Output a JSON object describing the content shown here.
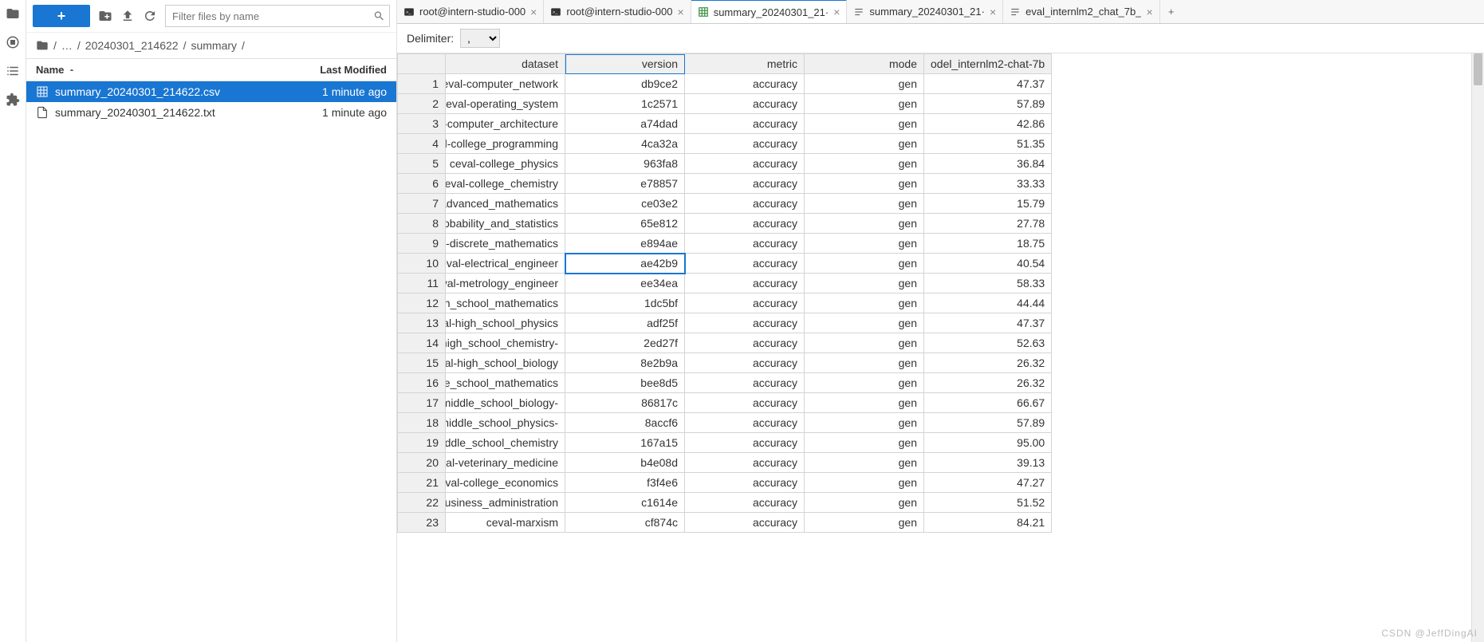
{
  "toolbar": {
    "new_label": "+",
    "filter_placeholder": "Filter files by name"
  },
  "breadcrumb": {
    "ellipsis": "…",
    "parts": [
      "20240301_214622",
      "summary"
    ]
  },
  "file_list": {
    "header_name": "Name",
    "header_modified": "Last Modified",
    "files": [
      {
        "name": "summary_20240301_214622.csv",
        "modified": "1 minute ago",
        "type": "csv",
        "selected": true
      },
      {
        "name": "summary_20240301_214622.txt",
        "modified": "1 minute ago",
        "type": "txt",
        "selected": false
      }
    ]
  },
  "tabs": [
    {
      "label": "root@intern-studio-000",
      "type": "terminal",
      "active": false
    },
    {
      "label": "root@intern-studio-000",
      "type": "terminal",
      "active": false
    },
    {
      "label": "summary_20240301_21·",
      "type": "csv",
      "active": true
    },
    {
      "label": "summary_20240301_21·",
      "type": "txt",
      "active": false
    },
    {
      "label": "eval_internlm2_chat_7b_",
      "type": "txt",
      "active": false
    }
  ],
  "delimiter": {
    "label": "Delimiter:",
    "value": ","
  },
  "chart_data": {
    "type": "table",
    "columns": [
      "dataset",
      "version",
      "metric",
      "mode",
      "odel_internlm2-chat-7b"
    ],
    "rows": [
      [
        "eval-computer_network",
        "db9ce2",
        "accuracy",
        "gen",
        "47.37"
      ],
      [
        "ceval-operating_system",
        "1c2571",
        "accuracy",
        "gen",
        "57.89"
      ],
      [
        "l-computer_architecture",
        "a74dad",
        "accuracy",
        "gen",
        "42.86"
      ],
      [
        "il-college_programming",
        "4ca32a",
        "accuracy",
        "gen",
        "51.35"
      ],
      [
        "ceval-college_physics",
        "963fa8",
        "accuracy",
        "gen",
        "36.84"
      ],
      [
        "ceval-college_chemistry",
        "e78857",
        "accuracy",
        "gen",
        "33.33"
      ],
      [
        "advanced_mathematics",
        "ce03e2",
        "accuracy",
        "gen",
        "15.79"
      ],
      [
        "robability_and_statistics",
        "65e812",
        "accuracy",
        "gen",
        "27.78"
      ],
      [
        "al-discrete_mathematics",
        "e894ae",
        "accuracy",
        "gen",
        "18.75"
      ],
      [
        "eval-electrical_engineer",
        "ae42b9",
        "accuracy",
        "gen",
        "40.54"
      ],
      [
        "val-metrology_engineer",
        "ee34ea",
        "accuracy",
        "gen",
        "58.33"
      ],
      [
        "gh_school_mathematics",
        "1dc5bf",
        "accuracy",
        "gen",
        "44.44"
      ],
      [
        "val-high_school_physics",
        "adf25f",
        "accuracy",
        "gen",
        "47.37"
      ],
      [
        "-high_school_chemistry",
        "2ed27f",
        "accuracy",
        "gen",
        "52.63"
      ],
      [
        "val-high_school_biology",
        "8e2b9a",
        "accuracy",
        "gen",
        "26.32"
      ],
      [
        "dle_school_mathematics",
        "bee8d5",
        "accuracy",
        "gen",
        "26.32"
      ],
      [
        "-middle_school_biology",
        "86817c",
        "accuracy",
        "gen",
        "66.67"
      ],
      [
        "-middle_school_physics",
        "8accf6",
        "accuracy",
        "gen",
        "57.89"
      ],
      [
        "iiddle_school_chemistry",
        "167a15",
        "accuracy",
        "gen",
        "95.00"
      ],
      [
        "val-veterinary_medicine",
        "b4e08d",
        "accuracy",
        "gen",
        "39.13"
      ],
      [
        "eval-college_economics",
        "f3f4e6",
        "accuracy",
        "gen",
        "47.27"
      ],
      [
        "business_administration",
        "c1614e",
        "accuracy",
        "gen",
        "51.52"
      ],
      [
        "ceval-marxism",
        "cf874c",
        "accuracy",
        "gen",
        "84.21"
      ]
    ],
    "selected_cell": {
      "row": 10,
      "col": 1
    }
  },
  "watermark": "CSDN @JeffDingAI"
}
